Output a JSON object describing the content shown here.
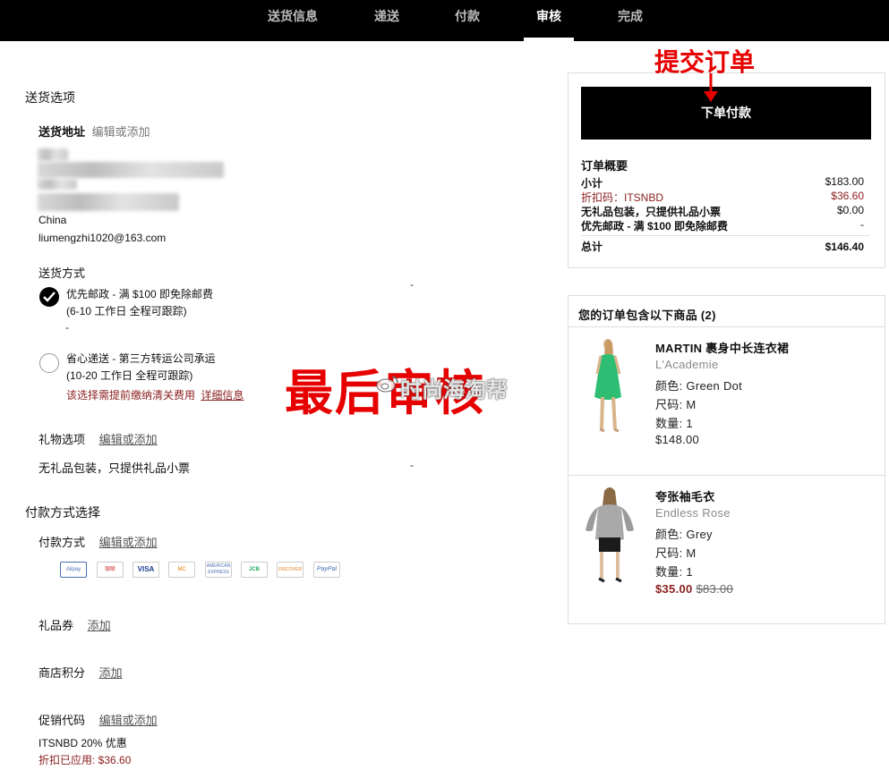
{
  "nav": {
    "steps": [
      {
        "label": "送货信息"
      },
      {
        "label": "递送"
      },
      {
        "label": "付款"
      },
      {
        "label": "审核"
      },
      {
        "label": "完成"
      }
    ]
  },
  "shipping": {
    "section_title": "送货选项",
    "address_label": "送货地址",
    "address_edit": "编辑或添加",
    "country": "China",
    "email": "liumengzhi1020@163.com",
    "method_label": "送货方式",
    "options": [
      {
        "title": "优先邮政 - 满 $100 即免除邮费",
        "detail": "(6-10 工作日 全程可跟踪)",
        "price": "-",
        "sub": "-"
      },
      {
        "title": "省心递送 - 第三方转运公司承运",
        "detail": "(10-20 工作日 全程可跟踪)",
        "note": "该选择需提前缴纳清关费用",
        "note_link": "详细信息"
      }
    ],
    "gift_label": "礼物选项",
    "gift_edit": "编辑或添加",
    "gift_value": "无礼品包装，只提供礼品小票",
    "gift_price": "-"
  },
  "payment": {
    "section_title": "付款方式选择",
    "method_label": "付款方式",
    "method_edit": "编辑或添加",
    "icons": [
      {
        "name": "alipay-icon",
        "text": "Alipay"
      },
      {
        "name": "unionpay-icon",
        "text": "银联"
      },
      {
        "name": "visa-icon",
        "text": "VISA"
      },
      {
        "name": "mastercard-icon",
        "text": "MC"
      },
      {
        "name": "amex-icon",
        "text": "AMERICAN EXPRESS"
      },
      {
        "name": "jcb-icon",
        "text": "JCB"
      },
      {
        "name": "discover-icon",
        "text": "DISCOVER"
      },
      {
        "name": "paypal-icon",
        "text": "PayPal"
      }
    ],
    "giftcard_label": "礼品券",
    "giftcard_link": "添加",
    "points_label": "商店积分",
    "points_link": "添加",
    "promo_label": "促销代码",
    "promo_edit": "编辑或添加",
    "promo_code": "ITSNBD 20% 优惠",
    "promo_applied": "折扣已应用: $36.60"
  },
  "summary": {
    "place_order": "下单付款",
    "title": "订单概要",
    "rows": [
      {
        "label": "小计",
        "value": "$183.00"
      },
      {
        "label": "折扣码：ITSNBD",
        "value": "$36.60"
      },
      {
        "label": "无礼品包装，只提供礼品小票",
        "value": "$0.00"
      },
      {
        "label": "优先邮政 - 满 $100 即免除邮费",
        "value": "-"
      }
    ],
    "total_label": "总计",
    "total_value": "$146.40"
  },
  "items": {
    "header": "您的订单包含以下商品 (2)",
    "list": [
      {
        "name": "MARTIN 裹身中长连衣裙",
        "brand": "L'Academie",
        "color": "颜色: Green Dot",
        "size": "尺码: M",
        "qty": "数量: 1",
        "price": "$148.00"
      },
      {
        "name": "夸张袖毛衣",
        "brand": "Endless Rose",
        "color": "颜色: Grey",
        "size": "尺码: M",
        "qty": "数量: 1",
        "sale_price": "$35.00",
        "orig_price": "$83.00"
      }
    ]
  },
  "annotations": {
    "submit": "提交订单",
    "final_review": "最后审核",
    "watermark": "时尚海淘帮"
  }
}
